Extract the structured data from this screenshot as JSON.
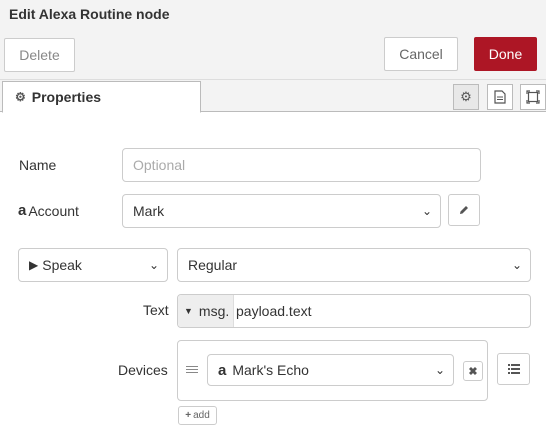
{
  "window": {
    "title": "Edit Alexa Routine node"
  },
  "toolbar": {
    "delete_label": "Delete",
    "cancel_label": "Cancel",
    "done_label": "Done"
  },
  "tabs": {
    "properties_label": "Properties",
    "properties_icon": "gear-icon"
  },
  "side_tabs": [
    {
      "icon": "gear-icon",
      "selected": true
    },
    {
      "icon": "document-icon",
      "selected": false
    },
    {
      "icon": "frame-icon",
      "selected": false
    }
  ],
  "form": {
    "name": {
      "label": "Name",
      "placeholder": "Optional",
      "value": ""
    },
    "account": {
      "label": "Account",
      "icon": "amazon-icon",
      "value": "Mark",
      "edit_icon": "pencil-icon"
    },
    "action": {
      "value": "Speak",
      "icon": "play-icon"
    },
    "speak_type": {
      "value": "Regular"
    },
    "text": {
      "label": "Text",
      "type_prefix": "msg.",
      "value": "payload.text"
    },
    "devices": {
      "label": "Devices",
      "items": [
        {
          "value": "Mark's Echo",
          "icon": "amazon-icon"
        }
      ],
      "add_label": "add"
    }
  },
  "colors": {
    "done_bg": "#ad1625",
    "toolbar_bg": "#f3f3f3"
  }
}
